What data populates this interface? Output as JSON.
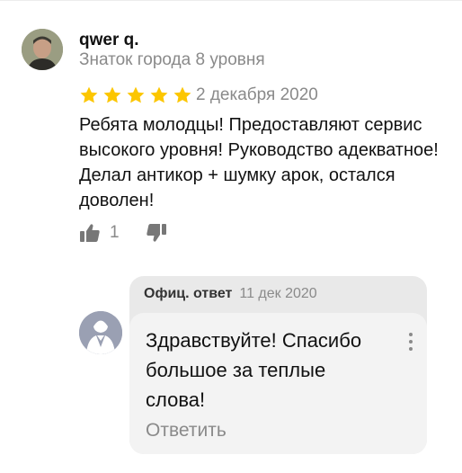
{
  "review": {
    "author": "qwer q.",
    "level": "Знаток города 8 уровня",
    "rating": 5,
    "date": "2 декабря 2020",
    "text": "Ребята молодцы! Предоставляют сервис высокого уровня! Руководство адекватное! Делал антикор + шумку арок, остался доволен!",
    "likes": "1"
  },
  "reply": {
    "label": "Офиц. ответ",
    "date": "11 дек 2020",
    "text": "Здравствуйте! Спасибо большое за теплые слова!",
    "action": "Ответить"
  },
  "colors": {
    "star": "#fcc600",
    "muted": "#8a8a8a",
    "card": "#e9e9e9",
    "bubble": "#f3f3f3"
  }
}
